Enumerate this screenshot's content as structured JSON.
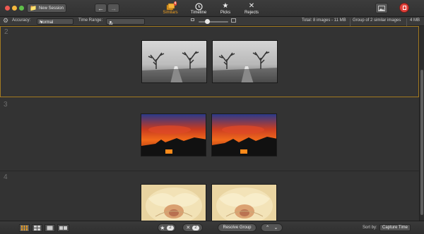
{
  "toolbar": {
    "new_session_label": "New Session",
    "nav": [
      {
        "label": "Similars",
        "badge": "4",
        "active": true
      },
      {
        "label": "Timeline"
      },
      {
        "label": "Picks"
      },
      {
        "label": "Rejects"
      }
    ]
  },
  "options": {
    "accuracy_label": "Accuracy:",
    "accuracy_value": "Normal",
    "time_range_label": "Time Range:",
    "time_range_value": "∞",
    "total": "Total: 8 images - 11 MB",
    "group_info": "Group of 2 similar images",
    "group_size": "4 MB"
  },
  "groups": [
    {
      "number": "2",
      "theme": "winter trees"
    },
    {
      "number": "3",
      "theme": "sunset silhouette"
    },
    {
      "number": "4",
      "theme": "rose"
    }
  ],
  "bottom": {
    "star_count": "2",
    "reject_count": "2",
    "resolve_label": "Resolve Group",
    "sort_label": "Sort by:",
    "sort_value": "Capture Time"
  },
  "colors": {
    "accent": "#f0a020",
    "selected_border": "#a37a20"
  }
}
